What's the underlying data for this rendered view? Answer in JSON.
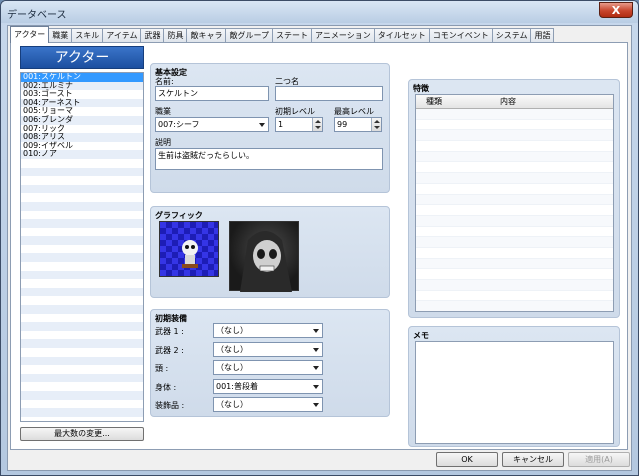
{
  "window": {
    "title": "データベース",
    "close_glyph": "X"
  },
  "tabs": [
    {
      "label": "アクター",
      "active": true
    },
    {
      "label": "職業"
    },
    {
      "label": "スキル"
    },
    {
      "label": "アイテム"
    },
    {
      "label": "武器"
    },
    {
      "label": "防具"
    },
    {
      "label": "敵キャラ"
    },
    {
      "label": "敵グループ"
    },
    {
      "label": "ステート"
    },
    {
      "label": "アニメーション"
    },
    {
      "label": "タイルセット"
    },
    {
      "label": "コモンイベント"
    },
    {
      "label": "システム"
    },
    {
      "label": "用語"
    }
  ],
  "actor_panel": {
    "header": "アクター",
    "items": [
      "001:スケルトン",
      "002:エルミナ",
      "003:ゴースト",
      "004:アーネスト",
      "005:リョーマ",
      "006:ブレンダ",
      "007:リック",
      "008:アリス",
      "009:イザベル",
      "010:ノア"
    ],
    "selected_index": 0,
    "max_button": "最大数の変更..."
  },
  "basic": {
    "title": "基本設定",
    "name_label": "名前:",
    "name_value": "スケルトン",
    "nickname_label": "二つ名",
    "nickname_value": "",
    "class_label": "職業",
    "class_value": "007:シーフ",
    "init_level_label": "初期レベル",
    "init_level_value": "1",
    "max_level_label": "最高レベル",
    "max_level_value": "99",
    "desc_label": "説明",
    "desc_value": "生前は盗賊だったらしい。"
  },
  "graphic": {
    "title": "グラフィック"
  },
  "equipment": {
    "title": "初期装備",
    "slots": [
      {
        "label": "武器 1 :",
        "value": "（なし）"
      },
      {
        "label": "武器 2 :",
        "value": "（なし）"
      },
      {
        "label": "頭 :",
        "value": "（なし）"
      },
      {
        "label": "身体 :",
        "value": "001:普段着"
      },
      {
        "label": "装飾品 :",
        "value": "（なし）"
      }
    ]
  },
  "traits": {
    "title": "特徴",
    "col_type": "種類",
    "col_content": "内容"
  },
  "memo": {
    "title": "メモ",
    "value": ""
  },
  "buttons": {
    "ok": "OK",
    "cancel": "キャンセル",
    "apply": "適用(A)"
  },
  "colors": {
    "selection": "#3399ff",
    "header_blue": "#1c4fa0",
    "panel": "#d4e0ee"
  }
}
